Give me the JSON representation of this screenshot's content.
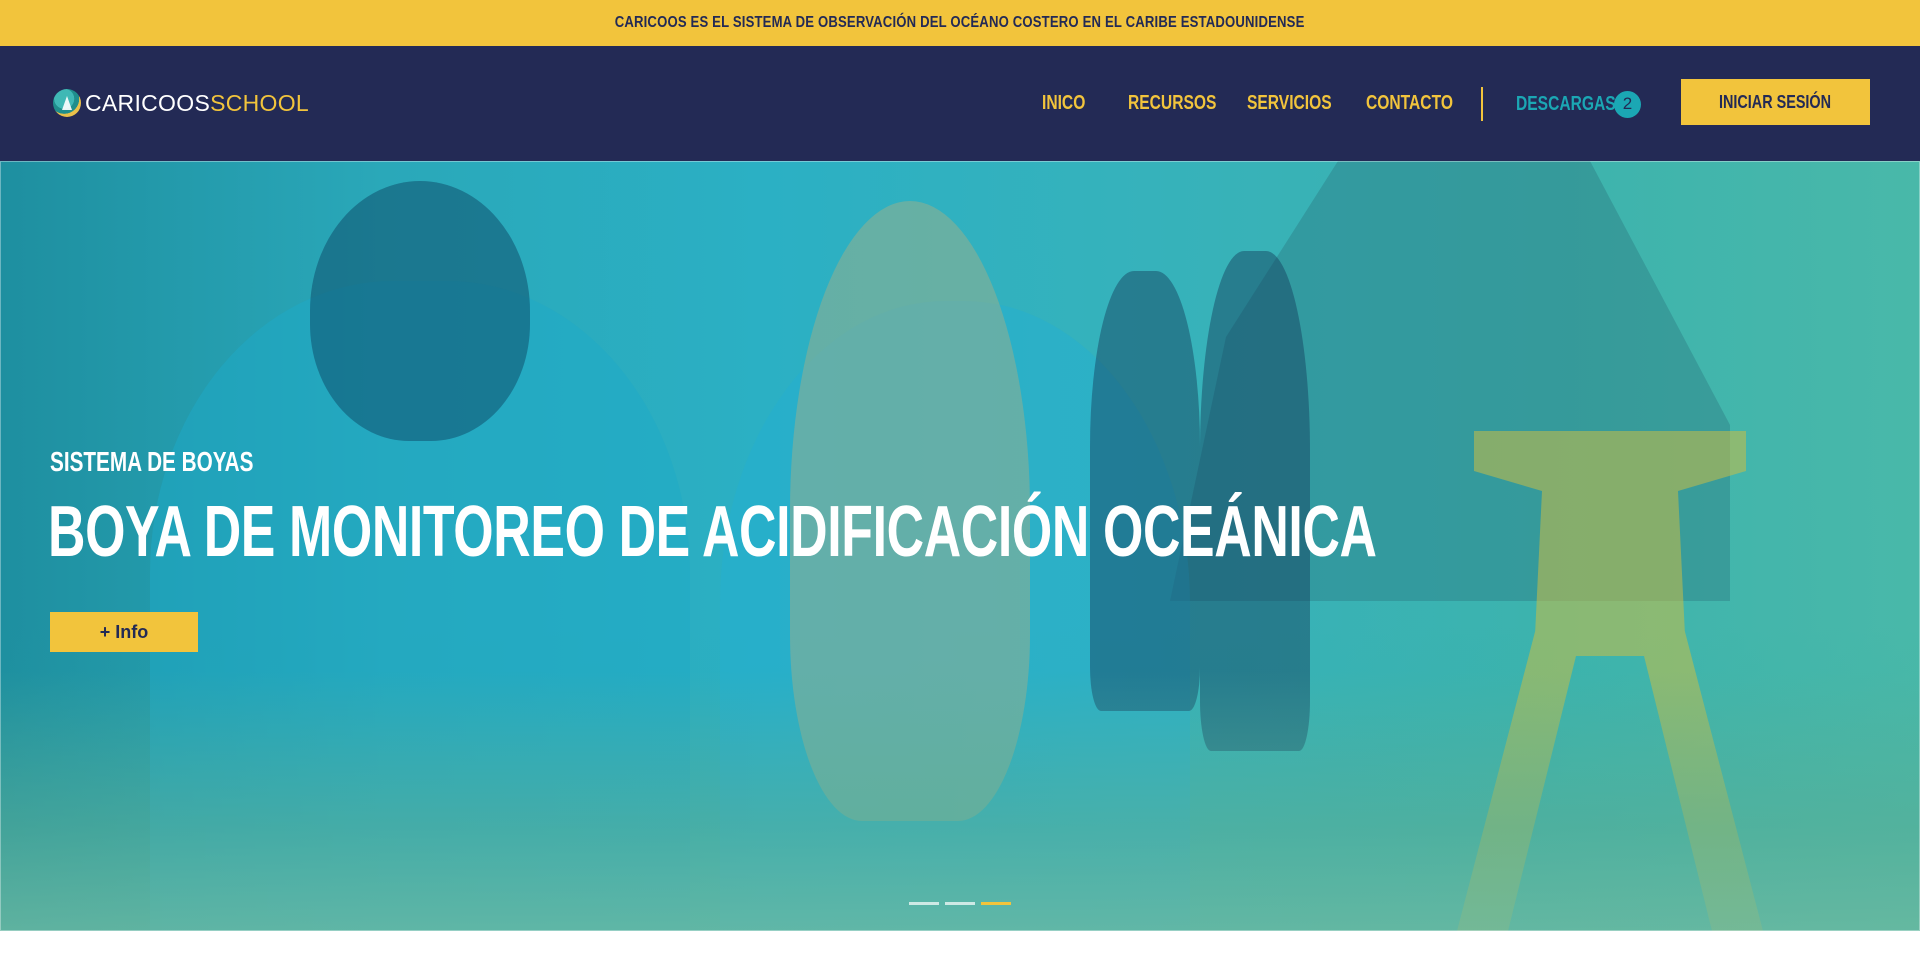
{
  "announcement": "CARICOOS ES EL SISTEMA DE OBSERVACIÓN DEL OCÉANO COSTERO EN EL CARIBE ESTADOUNIDENSE",
  "logo": {
    "part_a": "CARICOOS",
    "part_b": "SCHOOL"
  },
  "nav": {
    "items": [
      {
        "label": "INICO"
      },
      {
        "label": "RECURSOS"
      },
      {
        "label": "SERVICIOS"
      },
      {
        "label": "CONTACTO"
      }
    ],
    "downloads_label": "DESCARGAS",
    "downloads_count": "2",
    "login_label": "INICIAR SESIÓN"
  },
  "hero": {
    "kicker": "SISTEMA DE BOYAS",
    "title": "BOYA DE MONITOREO DE ACIDIFICACIÓN OCEÁNICA",
    "cta": "+ Info",
    "slides_total": 3,
    "active_slide": 3
  },
  "colors": {
    "navy": "#232a55",
    "yellow": "#f2c43c",
    "teal": "#1ba7b4"
  }
}
